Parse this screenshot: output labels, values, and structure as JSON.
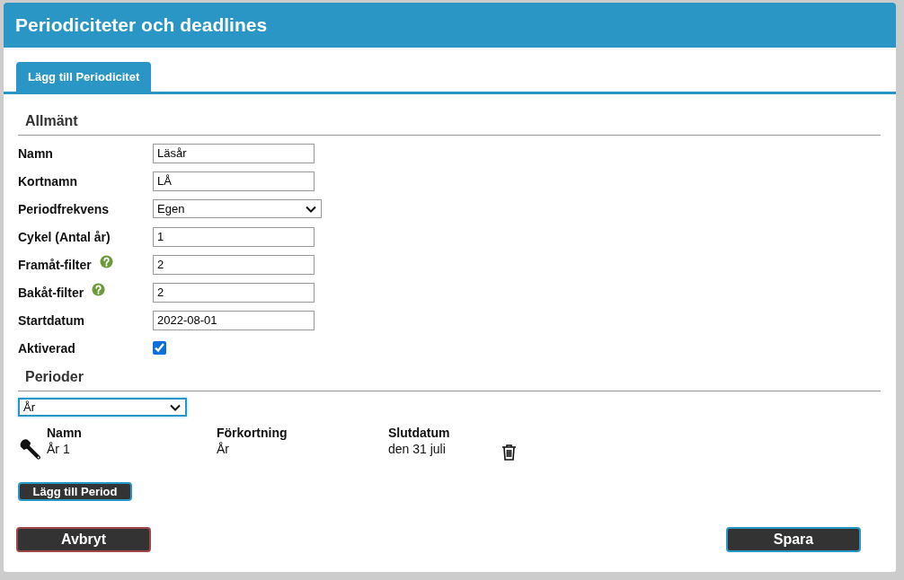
{
  "header": {
    "title": "Periodiciteter och deadlines"
  },
  "tabs": [
    {
      "label": "Lägg till Periodicitet",
      "selected": true
    }
  ],
  "general": {
    "heading": "Allmänt",
    "fields": [
      {
        "kind": "text",
        "label": "Namn",
        "value": "Läsår",
        "help": false
      },
      {
        "kind": "text",
        "label": "Kortnamn",
        "value": "LÅ",
        "help": false
      },
      {
        "kind": "select",
        "label": "Periodfrekvens",
        "value": "Egen",
        "help": false
      },
      {
        "kind": "text",
        "label": "Cykel (Antal år)",
        "value": "1",
        "help": false
      },
      {
        "kind": "text",
        "label": "Framåt-filter",
        "value": "2",
        "help": true
      },
      {
        "kind": "text",
        "label": "Bakåt-filter",
        "value": "2",
        "help": true
      },
      {
        "kind": "text",
        "label": "Startdatum",
        "value": "2022-08-01",
        "help": false
      },
      {
        "kind": "checkbox",
        "label": "Aktiverad",
        "checked": true
      }
    ]
  },
  "periods": {
    "heading": "Perioder",
    "type_select": {
      "value": "År"
    },
    "columns": [
      "Namn",
      "Förkortning",
      "Slutdatum"
    ],
    "rows": [
      {
        "name": "År 1",
        "abbreviation": "År",
        "end_date": "den 31 juli"
      }
    ],
    "add_button": "Lägg till Period"
  },
  "footer": {
    "cancel_button": "Avbryt",
    "save_button": "Spara"
  }
}
